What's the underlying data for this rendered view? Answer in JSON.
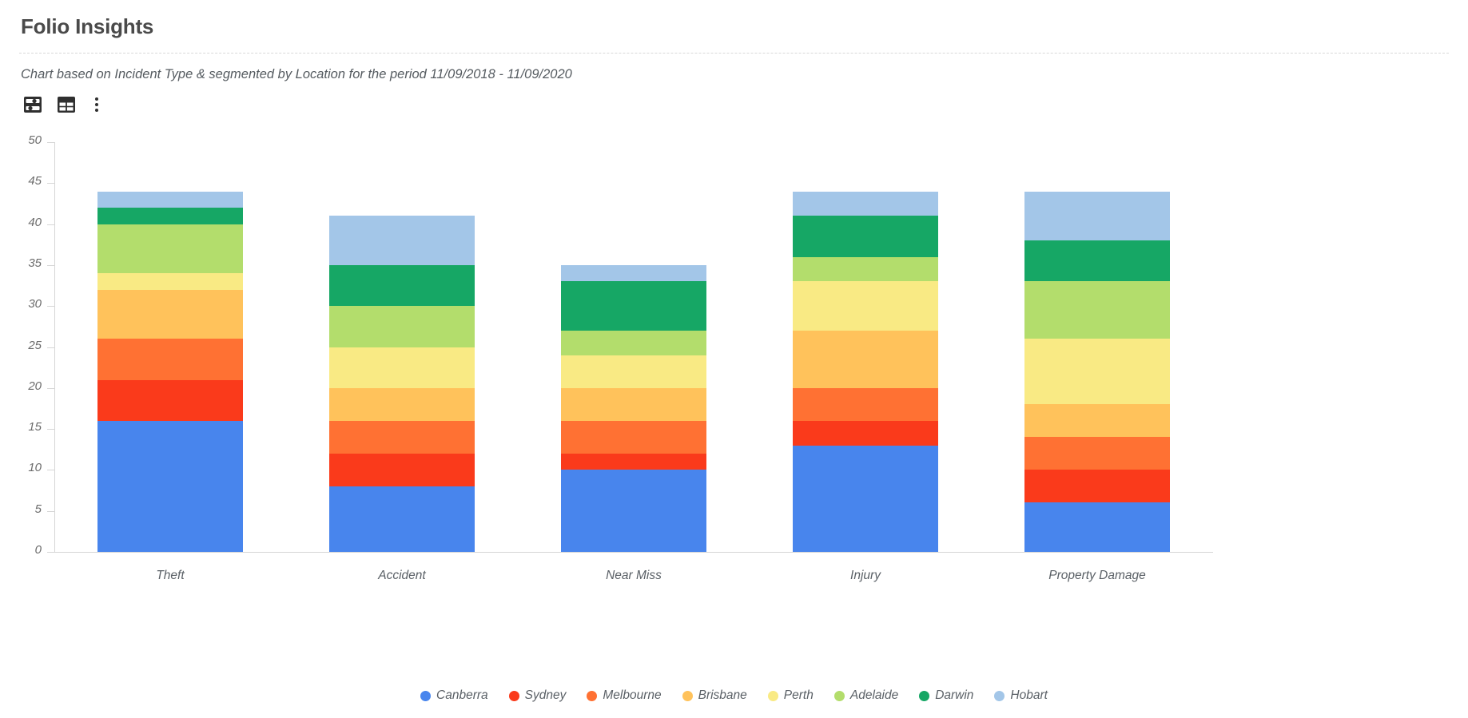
{
  "header": {
    "title": "Folio Insights",
    "subtitle": "Chart based on Incident Type & segmented by Location for the period 11/09/2018 - 11/09/2020"
  },
  "toolbar": {
    "items": [
      {
        "name": "chart-settings-icon",
        "label": "Chart settings"
      },
      {
        "name": "table-view-icon",
        "label": "Table view"
      },
      {
        "name": "more-options-icon",
        "label": "More options"
      }
    ]
  },
  "chart_data": {
    "type": "bar",
    "stacked": true,
    "title": "Folio Insights",
    "subtitle": "Chart based on Incident Type & segmented by Location for the period 11/09/2018 - 11/09/2020",
    "xlabel": "",
    "ylabel": "",
    "ylim": [
      0,
      50
    ],
    "yticks": [
      0,
      5,
      10,
      15,
      20,
      25,
      30,
      35,
      40,
      45,
      50
    ],
    "grid": false,
    "legend_position": "bottom",
    "categories": [
      "Theft",
      "Accident",
      "Near Miss",
      "Injury",
      "Property Damage"
    ],
    "totals": [
      44,
      41,
      35,
      44,
      44
    ],
    "series": [
      {
        "name": "Canberra",
        "color": "#4885ed",
        "values": [
          16,
          8,
          10,
          13,
          6
        ]
      },
      {
        "name": "Sydney",
        "color": "#fa3a1b",
        "values": [
          5,
          4,
          2,
          3,
          4
        ]
      },
      {
        "name": "Melbourne",
        "color": "#ff7133",
        "values": [
          5,
          4,
          4,
          4,
          4
        ]
      },
      {
        "name": "Brisbane",
        "color": "#ffc25b",
        "values": [
          6,
          4,
          4,
          7,
          4
        ]
      },
      {
        "name": "Perth",
        "color": "#f9ea84",
        "values": [
          2,
          5,
          4,
          6,
          8
        ]
      },
      {
        "name": "Adelaide",
        "color": "#b3dd6c",
        "values": [
          6,
          5,
          3,
          3,
          7
        ]
      },
      {
        "name": "Darwin",
        "color": "#16a765",
        "values": [
          2,
          5,
          6,
          5,
          5
        ]
      },
      {
        "name": "Hobart",
        "color": "#a3c6e8",
        "values": [
          2,
          6,
          2,
          3,
          6
        ]
      }
    ]
  }
}
